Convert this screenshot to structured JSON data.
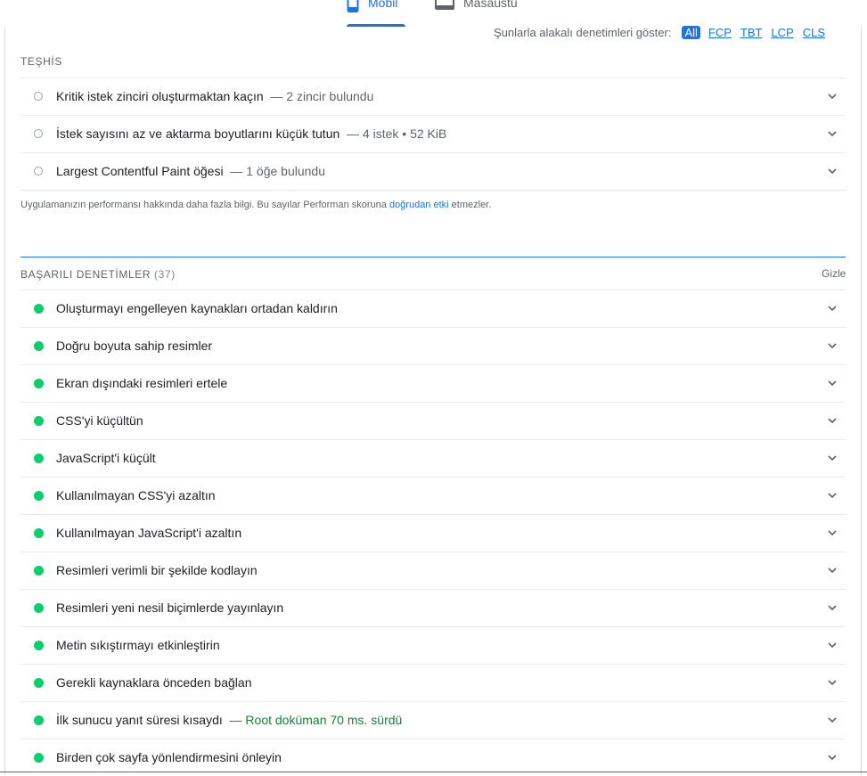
{
  "tabs": [
    {
      "label": "Mobil",
      "icon": "phone-icon"
    },
    {
      "label": "Masaüstü",
      "icon": "desktop-icon"
    }
  ],
  "filter": {
    "label": "Şunlarla alakalı denetimleri göster:",
    "chips": [
      "All",
      "FCP",
      "TBT",
      "LCP",
      "CLS"
    ]
  },
  "diagnostics": {
    "title": "TEŞHİS",
    "items": [
      {
        "title": "Kritik istek zinciri oluşturmaktan kaçın",
        "detail": "— 2 zincir bulundu"
      },
      {
        "title": "İstek sayısını az ve aktarma boyutlarını küçük tutun",
        "detail": "— 4 istek • 52 KiB"
      },
      {
        "title": "Largest Contentful Paint öğesi",
        "detail": "— 1 öğe bulundu"
      }
    ],
    "note": {
      "before": "Uygulamanızın performansı hakkında daha fazla bilgi. Bu sayılar Performan skoruna ",
      "link": "doğrudan etki",
      "after": " etmezler."
    }
  },
  "passed": {
    "title": "BAŞARILI DENETİMLER",
    "count": "(37)",
    "hide": "Gizle",
    "items": [
      {
        "title": "Oluşturmayı engelleyen kaynakları ortadan kaldırın",
        "detail": ""
      },
      {
        "title": "Doğru boyuta sahip resimler",
        "detail": ""
      },
      {
        "title": "Ekran dışındaki resimleri ertele",
        "detail": ""
      },
      {
        "title": "CSS'yi küçültün",
        "detail": ""
      },
      {
        "title": "JavaScript'i küçült",
        "detail": ""
      },
      {
        "title": "Kullanılmayan CSS'yi azaltın",
        "detail": ""
      },
      {
        "title": "Kullanılmayan JavaScript'i azaltın",
        "detail": ""
      },
      {
        "title": "Resimleri verimli bir şekilde kodlayın",
        "detail": ""
      },
      {
        "title": "Resimleri yeni nesil biçimlerde yayınlayın",
        "detail": ""
      },
      {
        "title": "Metin sıkıştırmayı etkinleştirin",
        "detail": ""
      },
      {
        "title": "Gerekli kaynaklara önceden bağlan",
        "detail": ""
      },
      {
        "title": "İlk sunucu yanıt süresi kısaydı",
        "detail": "— Root doküman 70 ms. sürdü"
      },
      {
        "title": "Birden çok sayfa yönlendirmesini önleyin",
        "detail": ""
      }
    ]
  },
  "colors": {
    "accent": "#1a73e8",
    "pass": "#0cce6b",
    "pass_text": "#188038"
  }
}
